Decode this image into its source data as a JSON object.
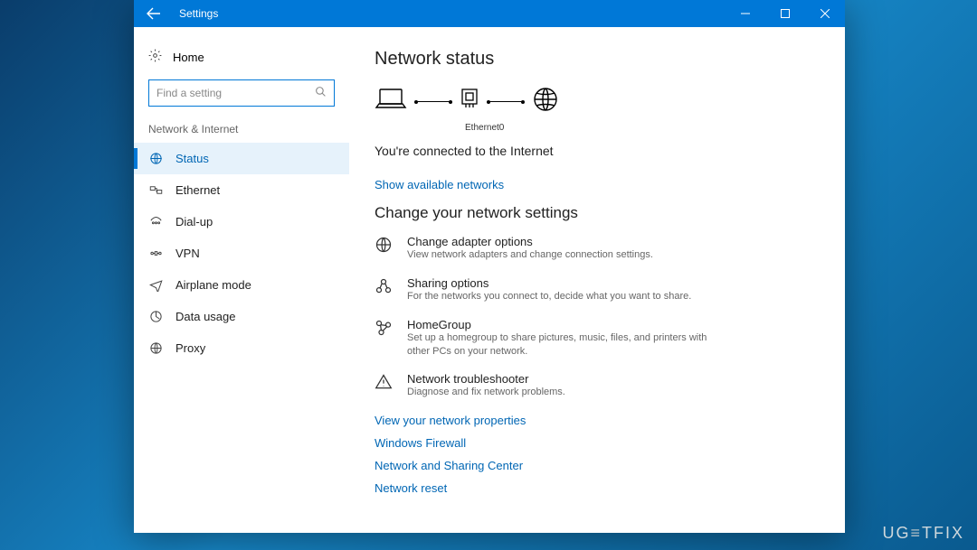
{
  "titlebar": {
    "title": "Settings"
  },
  "sidebar": {
    "home_label": "Home",
    "search_placeholder": "Find a setting",
    "section_label": "Network & Internet",
    "items": [
      {
        "label": "Status"
      },
      {
        "label": "Ethernet"
      },
      {
        "label": "Dial-up"
      },
      {
        "label": "VPN"
      },
      {
        "label": "Airplane mode"
      },
      {
        "label": "Data usage"
      },
      {
        "label": "Proxy"
      }
    ]
  },
  "main": {
    "page_title": "Network status",
    "diagram_label": "Ethernet0",
    "status_text": "You're connected to the Internet",
    "show_networks": "Show available networks",
    "section_title": "Change your network settings",
    "options": [
      {
        "title": "Change adapter options",
        "desc": "View network adapters and change connection settings."
      },
      {
        "title": "Sharing options",
        "desc": "For the networks you connect to, decide what you want to share."
      },
      {
        "title": "HomeGroup",
        "desc": "Set up a homegroup to share pictures, music, files, and printers with other PCs on your network."
      },
      {
        "title": "Network troubleshooter",
        "desc": "Diagnose and fix network problems."
      }
    ],
    "links": [
      "View your network properties",
      "Windows Firewall",
      "Network and Sharing Center",
      "Network reset"
    ]
  },
  "watermark": "UG  TFIX"
}
